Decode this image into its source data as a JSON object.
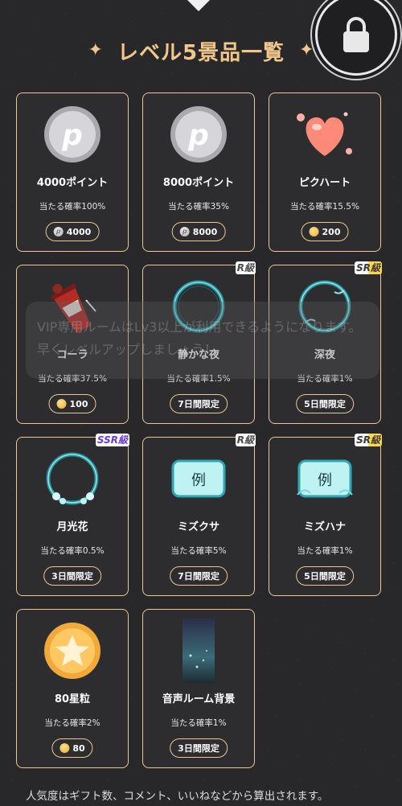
{
  "title": "レベル5景品一覧",
  "title_deco_icon": "sparkle",
  "lock_icon": "lock-icon",
  "colors": {
    "gold": "#e9c796",
    "title_gold": "#f1c78b",
    "background": "#28282a",
    "card_bg": "#2d2d2f"
  },
  "prizes": [
    {
      "name": "4000ポイント",
      "prob": "当たる確率100%",
      "value": "4000",
      "value_icon": "point-coin",
      "art": "silver-p-coin"
    },
    {
      "name": "8000ポイント",
      "prob": "当たる確率35%",
      "value": "8000",
      "value_icon": "point-coin",
      "art": "silver-p-coin"
    },
    {
      "name": "ピクハート",
      "prob": "当たる確率15.5%",
      "value": "200",
      "value_icon": "gold-coin",
      "art": "heart"
    },
    {
      "name": "コーラ",
      "prob": "当たる確率37.5%",
      "value": "100",
      "value_icon": "gold-coin",
      "art": "cola-cup"
    },
    {
      "name": "静かな夜",
      "prob": "当たる確率1.5%",
      "value": "7日間限定",
      "rank": "R級",
      "art": "avatar-frame"
    },
    {
      "name": "深夜",
      "prob": "当たる確率1%",
      "value": "5日間限定",
      "rank": "SR級",
      "art": "avatar-frame"
    },
    {
      "name": "月光花",
      "prob": "当たる確率0.5%",
      "value": "3日間限定",
      "rank": "SSR級",
      "art": "avatar-frame-flowers"
    },
    {
      "name": "ミズクサ",
      "prob": "当たる確率5%",
      "value": "7日間限定",
      "rank": "R級",
      "art": "chat-bubble",
      "art_text": "例"
    },
    {
      "name": "ミズハナ",
      "prob": "当たる確率1%",
      "value": "5日間限定",
      "rank": "SR級",
      "art": "chat-bubble-vines",
      "art_text": "例"
    },
    {
      "name": "80星粒",
      "prob": "当たる確率2%",
      "value": "80",
      "value_icon": "gold-coin",
      "art": "star-coin"
    },
    {
      "name": "音声ルーム背景",
      "prob": "当たる確率1%",
      "value": "3日間限定",
      "art": "room-background"
    }
  ],
  "toast_text": "VIP専用ルームはLv3以上が利用できるようになります。早くレベルアップしましょう！",
  "footnote": "人気度はギフト数、コメント、いいねなどから算出されます。"
}
